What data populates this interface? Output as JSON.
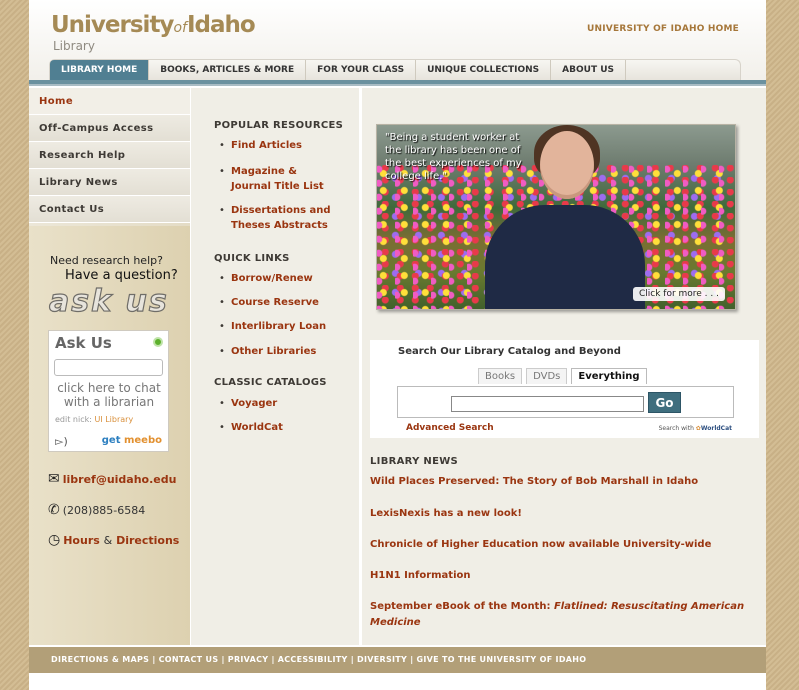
{
  "header": {
    "logo_main": "University",
    "logo_of": "of",
    "logo_idaho": "Idaho",
    "logo_sub": "Library",
    "top_link": "UNIVERSITY OF IDAHO HOME"
  },
  "nav": {
    "tabs": [
      "LIBRARY HOME",
      "BOOKS, ARTICLES & MORE",
      "FOR YOUR CLASS",
      "UNIQUE COLLECTIONS",
      "ABOUT US"
    ],
    "active": "LIBRARY HOME"
  },
  "sidebar": {
    "items": [
      "Home",
      "Off-Campus Access",
      "Research Help",
      "Library News",
      "Contact Us"
    ],
    "need_help": "Need research help?",
    "have_question": "Have a question?",
    "ask_us": "ask us",
    "widget": {
      "title": "Ask Us",
      "chat_text": "click here to chat with a librarian",
      "nick_label": "edit nick:",
      "nick_value": "UI Library",
      "meebo_get": "get",
      "meebo_brand": "meebo"
    },
    "email": "libref@uidaho.edu",
    "phone": "(208)885-6584",
    "hours": "Hours",
    "hours_amp": "&",
    "directions": "Directions"
  },
  "resources": {
    "popular_heading": "POPULAR RESOURCES",
    "popular": [
      "Find Articles",
      "Magazine & Journal Title List",
      "Dissertations and Theses Abstracts"
    ],
    "quick_heading": "QUICK LINKS",
    "quick": [
      "Borrow/Renew",
      "Course Reserve",
      "Interlibrary Loan",
      "Other Libraries"
    ],
    "classic_heading": "CLASSIC CATALOGS",
    "classic": [
      "Voyager",
      "WorldCat"
    ]
  },
  "feature": {
    "quote": "\"Being a student worker at the library has been one of the best experiences of my college life.\"",
    "more": "Click for more . . ."
  },
  "search": {
    "title": "Search Our Library Catalog and Beyond",
    "tabs": [
      "Books",
      "DVDs",
      "Everything"
    ],
    "active_tab": "Everything",
    "input_value": "",
    "go": "Go",
    "advanced": "Advanced Search",
    "searchwith": "Search with",
    "worldcat": "WorldCat"
  },
  "news": {
    "heading": "LIBRARY NEWS",
    "items": [
      "Wild Places Preserved: The Story of Bob Marshall in Idaho",
      "LexisNexis has a new look!",
      "Chronicle of Higher Education now available University-wide",
      "H1N1 Information"
    ],
    "ebook_prefix": "September eBook of the Month:",
    "ebook_title": "Flatlined: Resuscitating American Medicine"
  },
  "footer": {
    "links": "DIRECTIONS & MAPS | CONTACT US | PRIVACY | ACCESSIBILITY | DIVERSITY | GIVE TO THE UNIVERSITY OF IDAHO"
  },
  "colors": {
    "accent": "#9a3510",
    "nav_active": "#507f92",
    "brand_gold": "#a58a55"
  }
}
